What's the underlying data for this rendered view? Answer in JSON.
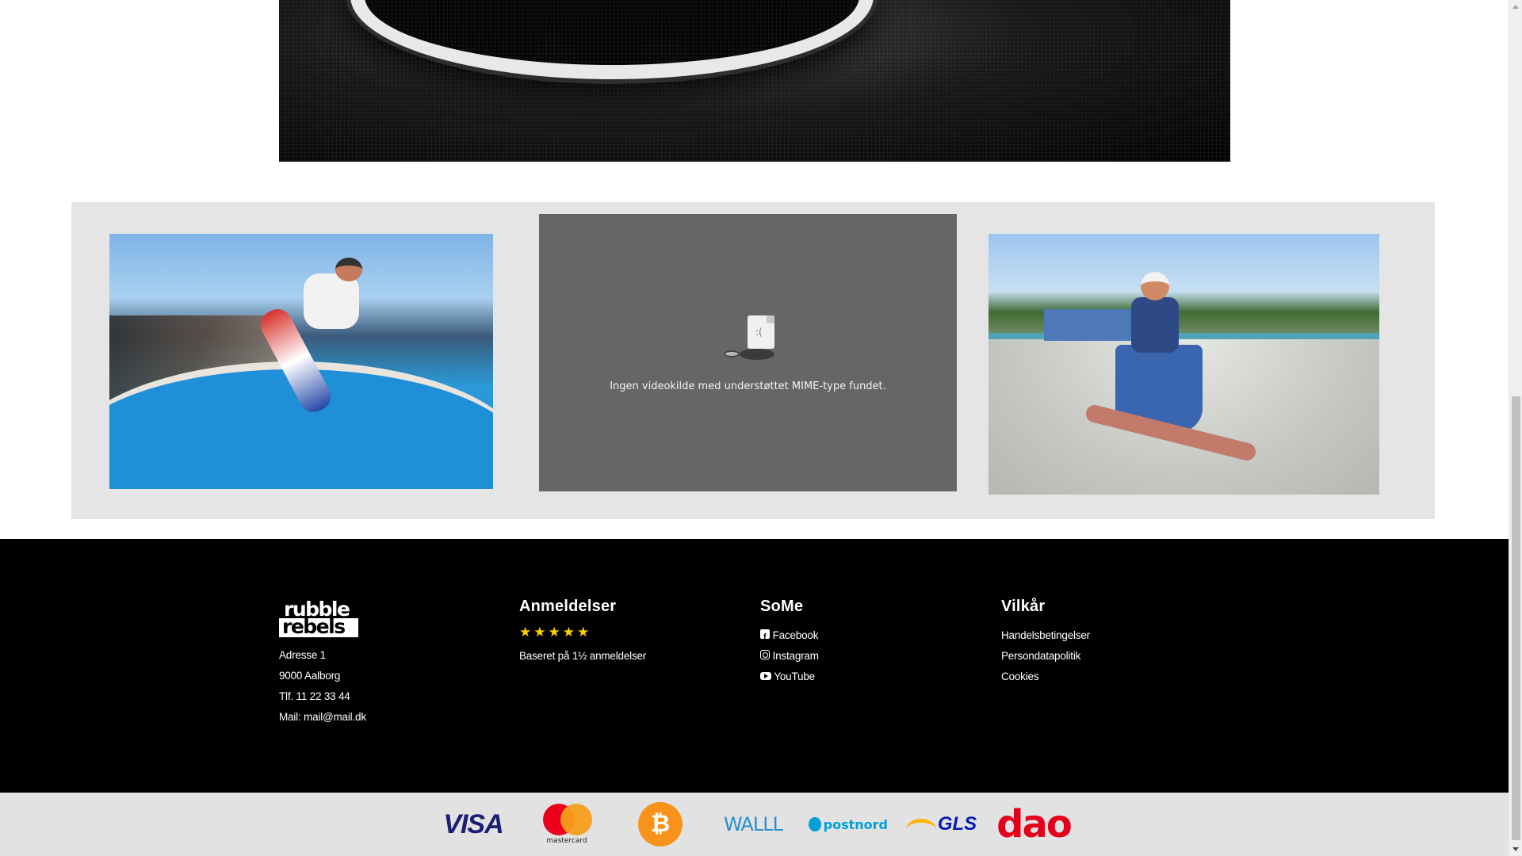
{
  "video": {
    "message": "Ingen videokilde med understøttet MIME-type fundet."
  },
  "footer": {
    "brand": {
      "logo_line1": "rubble",
      "logo_line2": "rebels",
      "address": "Adresse 1",
      "city": "9000 Aalborg",
      "phone": "Tlf. 11 22 33 44",
      "email": "Mail: mail@mail.dk"
    },
    "reviews": {
      "heading": "Anmeldelser",
      "rating": 5,
      "star_glyph": "★",
      "summary": "Baseret på 1½ anmeldelser"
    },
    "social": {
      "heading": "SoMe",
      "links": [
        {
          "label": "Facebook",
          "icon": "facebook-icon"
        },
        {
          "label": "Instagram",
          "icon": "instagram-icon"
        },
        {
          "label": "YouTube",
          "icon": "youtube-icon"
        }
      ]
    },
    "terms": {
      "heading": "Vilkår",
      "links": [
        "Handelsbetingelser",
        "Persondatapolitik",
        "Cookies"
      ]
    }
  },
  "payments": {
    "visa": "VISA",
    "mastercard": "mastercard",
    "bitcoin": "₿",
    "walley": "WALLL",
    "postnord": "postnord",
    "gls": "GLS",
    "dao": "dao"
  },
  "colors": {
    "footer_bg": "#000000",
    "payments_bg": "#e2e2e2",
    "media_band_bg": "#e5e5e5",
    "video_bg": "#666666",
    "star": "#ffd100"
  }
}
